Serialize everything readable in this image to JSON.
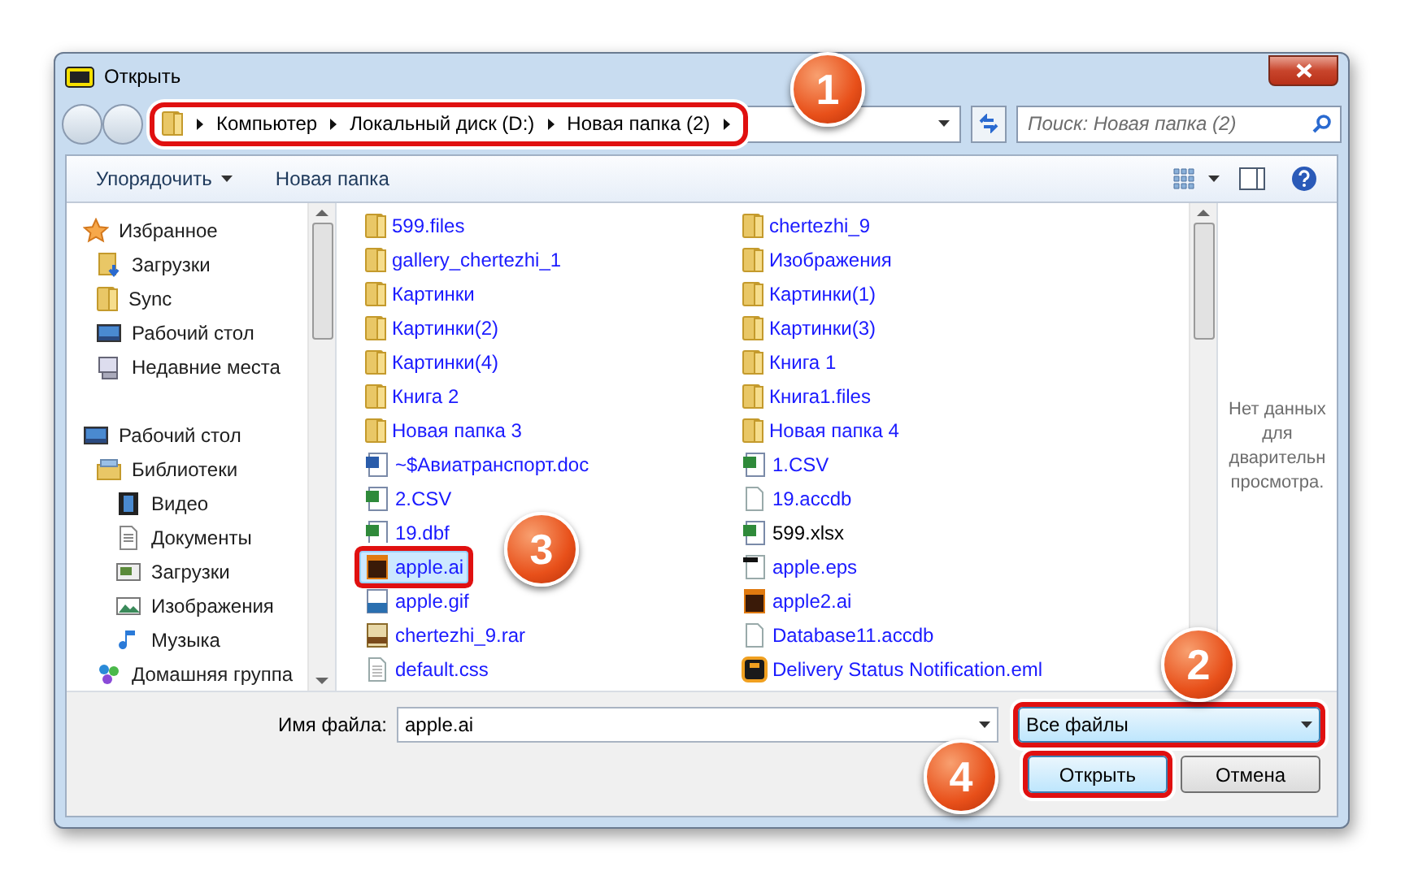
{
  "window": {
    "title": "Открыть"
  },
  "address": {
    "outlined": true,
    "segments": [
      "Компьютер",
      "Локальный диск (D:)",
      "Новая папка (2)"
    ]
  },
  "search": {
    "placeholder": "Поиск: Новая папка (2)"
  },
  "toolbar": {
    "organize": "Упорядочить",
    "new_folder": "Новая папка"
  },
  "sidebar": [
    {
      "label": "Избранное",
      "kind": "star",
      "children": [
        {
          "label": "Загрузки",
          "kind": "downloads-folder"
        },
        {
          "label": "Sync",
          "kind": "folder"
        },
        {
          "label": "Рабочий стол",
          "kind": "desktop"
        },
        {
          "label": "Недавние места",
          "kind": "recent"
        }
      ]
    },
    {
      "label": "Рабочий стол",
      "kind": "desktop",
      "children": [
        {
          "label": "Библиотеки",
          "kind": "library",
          "children": [
            {
              "label": "Видео",
              "kind": "video"
            },
            {
              "label": "Документы",
              "kind": "document"
            },
            {
              "label": "Загрузки",
              "kind": "downloads"
            },
            {
              "label": "Изображения",
              "kind": "image"
            },
            {
              "label": "Музыка",
              "kind": "music"
            }
          ]
        },
        {
          "label": "Домашняя группа",
          "kind": "homegroup"
        }
      ]
    }
  ],
  "files": [
    {
      "name": "599.files",
      "kind": "folder",
      "compressed": true,
      "selected": false,
      "outlined": false
    },
    {
      "name": "gallery_chertezhi_1",
      "kind": "folder",
      "compressed": true,
      "selected": false,
      "outlined": false
    },
    {
      "name": "Картинки",
      "kind": "folder",
      "compressed": true,
      "selected": false,
      "outlined": false
    },
    {
      "name": "Картинки(2)",
      "kind": "folder",
      "compressed": true,
      "selected": false,
      "outlined": false
    },
    {
      "name": "Картинки(4)",
      "kind": "folder",
      "compressed": true,
      "selected": false,
      "outlined": false
    },
    {
      "name": "Книга 2",
      "kind": "folder",
      "compressed": true,
      "selected": false,
      "outlined": false
    },
    {
      "name": "Новая папка 3",
      "kind": "folder",
      "compressed": true,
      "selected": false,
      "outlined": false
    },
    {
      "name": "~$Авиатранспорт.doc",
      "kind": "doc",
      "compressed": true,
      "selected": false,
      "outlined": false
    },
    {
      "name": "2.CSV",
      "kind": "sheet",
      "compressed": true,
      "selected": false,
      "outlined": false
    },
    {
      "name": "19.dbf",
      "kind": "sheet",
      "compressed": true,
      "selected": false,
      "outlined": false
    },
    {
      "name": "apple.ai",
      "kind": "ai",
      "compressed": true,
      "selected": true,
      "outlined": true
    },
    {
      "name": "apple.gif",
      "kind": "image",
      "compressed": true,
      "selected": false,
      "outlined": false
    },
    {
      "name": "chertezhi_9.rar",
      "kind": "rar",
      "compressed": true,
      "selected": false,
      "outlined": false
    },
    {
      "name": "default.css",
      "kind": "text",
      "compressed": true,
      "selected": false,
      "outlined": false
    },
    {
      "name": "chertezhi_9",
      "kind": "folder",
      "compressed": true,
      "selected": false,
      "outlined": false
    },
    {
      "name": "Изображения",
      "kind": "folder",
      "compressed": true,
      "selected": false,
      "outlined": false
    },
    {
      "name": "Картинки(1)",
      "kind": "folder",
      "compressed": true,
      "selected": false,
      "outlined": false
    },
    {
      "name": "Картинки(3)",
      "kind": "folder",
      "compressed": true,
      "selected": false,
      "outlined": false
    },
    {
      "name": "Книга 1",
      "kind": "folder",
      "compressed": true,
      "selected": false,
      "outlined": false
    },
    {
      "name": "Книга1.files",
      "kind": "folder",
      "compressed": true,
      "selected": false,
      "outlined": false
    },
    {
      "name": "Новая папка 4",
      "kind": "folder",
      "compressed": true,
      "selected": false,
      "outlined": false
    },
    {
      "name": "1.CSV",
      "kind": "sheet",
      "compressed": true,
      "selected": false,
      "outlined": false
    },
    {
      "name": "19.accdb",
      "kind": "blank",
      "compressed": true,
      "selected": false,
      "outlined": false
    },
    {
      "name": "599.xlsx",
      "kind": "sheet",
      "compressed": false,
      "selected": false,
      "outlined": false
    },
    {
      "name": "apple.eps",
      "kind": "eps",
      "compressed": true,
      "selected": false,
      "outlined": false
    },
    {
      "name": "apple2.ai",
      "kind": "ai",
      "compressed": true,
      "selected": false,
      "outlined": false
    },
    {
      "name": "Database11.accdb",
      "kind": "blank",
      "compressed": true,
      "selected": false,
      "outlined": false
    },
    {
      "name": "Delivery Status Notification.eml",
      "kind": "mail",
      "compressed": true,
      "selected": false,
      "outlined": false
    }
  ],
  "preview_message": [
    "Нет данных",
    "для",
    "дварительн",
    "просмотра."
  ],
  "filename": {
    "label": "Имя файла:",
    "value": "apple.ai"
  },
  "filetype": {
    "value": "Все файлы",
    "outlined": true
  },
  "buttons": [
    {
      "label": "Открыть",
      "kind": "default",
      "outlined": true
    },
    {
      "label": "Отмена",
      "kind": "normal",
      "outlined": false
    }
  ],
  "callouts": [
    {
      "number": "1"
    },
    {
      "number": "2"
    },
    {
      "number": "3"
    },
    {
      "number": "4"
    }
  ]
}
